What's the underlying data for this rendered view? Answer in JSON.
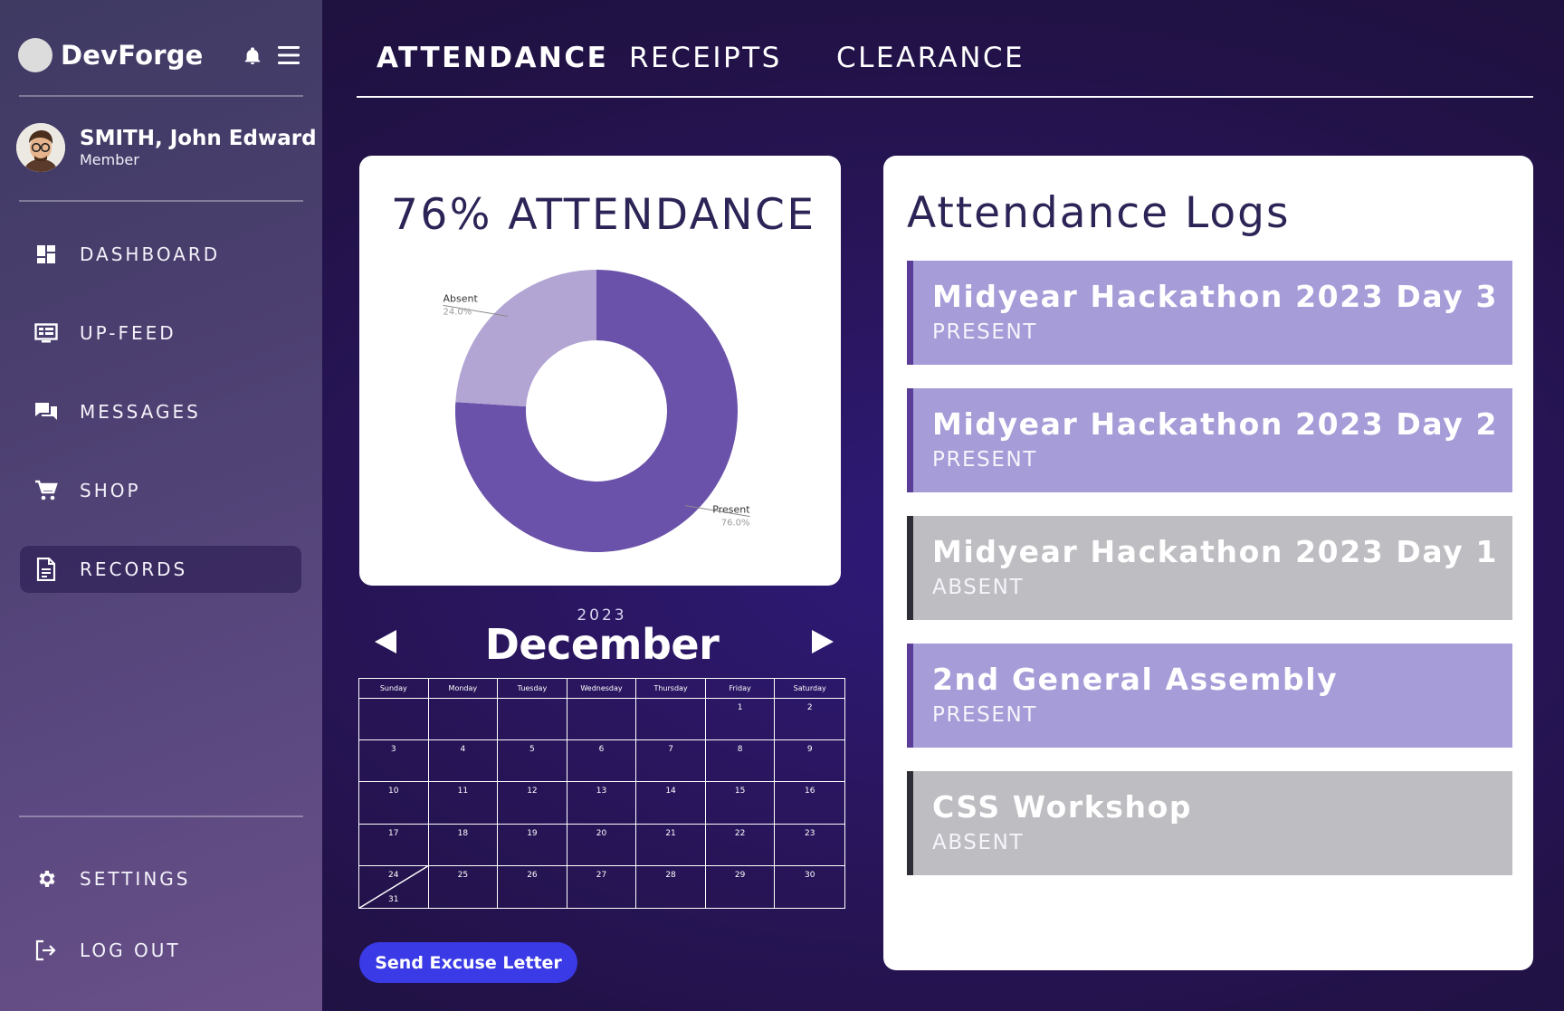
{
  "app": {
    "name": "DevForge"
  },
  "user": {
    "name": "SMITH, John Edward",
    "role": "Member"
  },
  "nav": [
    {
      "label": "DASHBOARD",
      "icon": "dashboard-icon"
    },
    {
      "label": "UP-FEED",
      "icon": "feed-icon"
    },
    {
      "label": "MESSAGES",
      "icon": "messages-icon"
    },
    {
      "label": "SHOP",
      "icon": "cart-icon"
    },
    {
      "label": "RECORDS",
      "icon": "records-icon",
      "active": true
    }
  ],
  "nav_bottom": [
    {
      "label": "SETTINGS",
      "icon": "gear-icon"
    },
    {
      "label": "LOG OUT",
      "icon": "logout-icon"
    }
  ],
  "tabs": [
    {
      "label": "ATTENDANCE",
      "active": true
    },
    {
      "label": "RECEIPTS"
    },
    {
      "label": "CLEARANCE"
    }
  ],
  "attendance": {
    "title": "76% ATTENDANCE"
  },
  "chart_data": {
    "type": "pie",
    "donut": true,
    "slices": [
      {
        "label": "Present",
        "value": 76.0,
        "display": "76.0%",
        "color": "#6a52aa"
      },
      {
        "label": "Absent",
        "value": 24.0,
        "display": "24.0%",
        "color": "#b2a5d4"
      }
    ]
  },
  "calendar": {
    "year": "2023",
    "month": "December",
    "weekdays": [
      "Sunday",
      "Monday",
      "Tuesday",
      "Wednesday",
      "Thursday",
      "Friday",
      "Saturday"
    ],
    "weeks": [
      [
        "",
        "",
        "",
        "",
        "",
        "1",
        "2"
      ],
      [
        "3",
        "4",
        "5",
        "6",
        "7",
        "8",
        "9"
      ],
      [
        "10",
        "11",
        "12",
        "13",
        "14",
        "15",
        "16"
      ],
      [
        "17",
        "18",
        "19",
        "20",
        "21",
        "22",
        "23"
      ],
      [
        "24/31",
        "25",
        "26",
        "27",
        "28",
        "29",
        "30"
      ]
    ]
  },
  "excuse_button": "Send Excuse Letter",
  "logs": {
    "title": "Attendance Logs",
    "items": [
      {
        "name": "Midyear Hackathon 2023 Day 3",
        "status": "PRESENT"
      },
      {
        "name": "Midyear Hackathon 2023 Day 2",
        "status": "PRESENT"
      },
      {
        "name": "Midyear Hackathon 2023 Day 1",
        "status": "ABSENT"
      },
      {
        "name": "2nd General Assembly",
        "status": "PRESENT"
      },
      {
        "name": "CSS Workshop",
        "status": "ABSENT"
      }
    ]
  },
  "colors": {
    "present_bg": "#a59cd8",
    "present_bar": "#5a3d98",
    "absent_bg": "#bebdc2",
    "absent_bar": "#2d2d35",
    "title_text": "#2c2456",
    "button": "#3a3ae6"
  }
}
